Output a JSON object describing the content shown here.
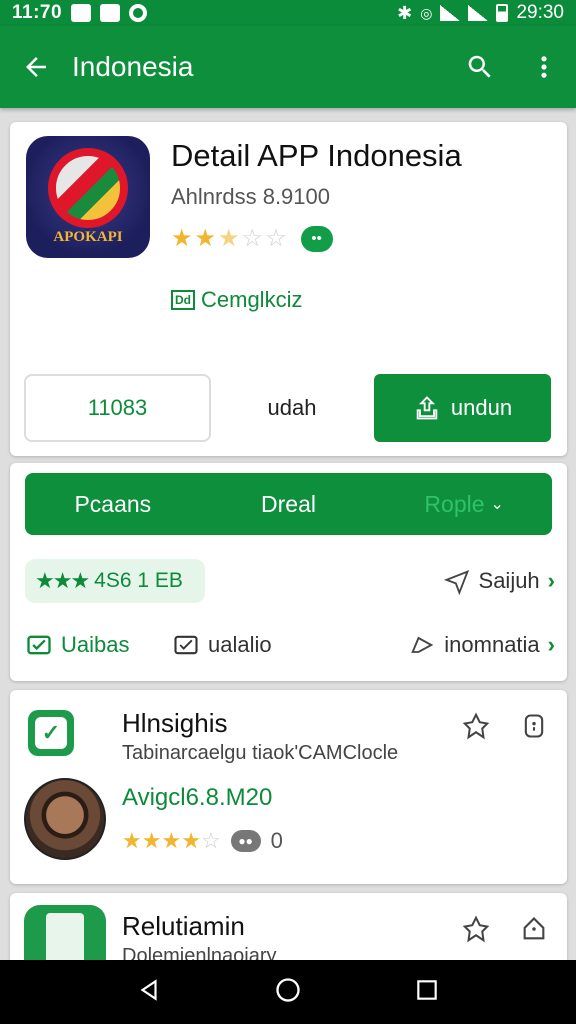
{
  "status_bar": {
    "time_left": "11:70",
    "time_right": "29:30"
  },
  "app_bar": {
    "title": "Indonesia"
  },
  "app_card": {
    "icon_label": "APOKAPI",
    "title": "Detail APP Indonesia",
    "subtitle": "Ahlnrdss 8.9100",
    "rating": 2.5,
    "tag_box": "Dd",
    "tag_text": "Cemglkciz",
    "btn_outline_label": "11083",
    "btn_text_label": "udah",
    "btn_primary_label": "undun"
  },
  "info_card": {
    "tabs": [
      {
        "label": "Pcaans"
      },
      {
        "label": "Dreal"
      },
      {
        "label": "Rople"
      }
    ],
    "rating_chip_text": "4S6 1 EB",
    "share_link": "Saijuh",
    "left_item": "Uaibas",
    "mid_item": "ualalio",
    "right_link": "inomnatia"
  },
  "review_card": {
    "title": "Hlnsighis",
    "subtitle": "Tabinarcaelgu tiaok'CAMClocle",
    "meta": "Avigcl6.8.M20",
    "rating": 4.5,
    "count": "0"
  },
  "bottom_card": {
    "title": "Relutiamin",
    "subtitle": "Dolemienlnaoiary"
  },
  "colors": {
    "primary": "#0d8f3c",
    "star": "#f2b530"
  }
}
